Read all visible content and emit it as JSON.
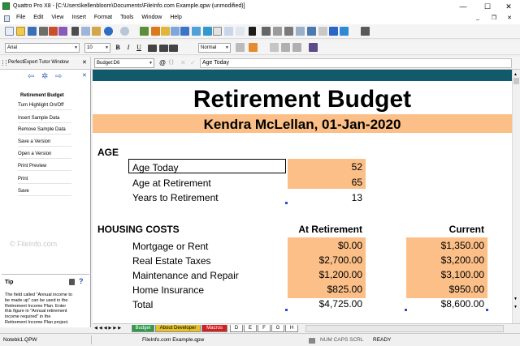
{
  "window": {
    "title": "Quattro Pro X8 - [C:\\Users\\kellenbloom\\Documents\\FileInfo.com Example.qpw (unmodified)]",
    "minimize": "—",
    "maximize": "☐",
    "close": "✕"
  },
  "menu": {
    "items": [
      "File",
      "Edit",
      "View",
      "Insert",
      "Format",
      "Tools",
      "Window",
      "Help"
    ],
    "mdi_minimize": "_",
    "mdi_restore": "❐",
    "mdi_close": "✕"
  },
  "format_toolbar": {
    "font": "Arial",
    "size": "10",
    "bold": "B",
    "italic": "I",
    "underline": "U",
    "style": "Normal"
  },
  "input_line": {
    "tutor_title": "PerfectExpert Tutor Window",
    "cell_address": "Budget:D6",
    "at_symbol": "@",
    "braces": "{ }",
    "cancel": "✕",
    "confirm": "✓",
    "content": "Age Today"
  },
  "tutor": {
    "nav_back": "⇦",
    "nav_home": "✲",
    "nav_forward": "⇨",
    "close": "✕",
    "heading": "Retirement Budget",
    "items": [
      "Turn Highlight On/Off",
      "Insert Sample Data",
      "Remove Sample Data",
      "Save a Version",
      "Open a Version",
      "Print Preview",
      "Print",
      "Save"
    ],
    "watermark": "© FileInfo.com",
    "tip_label": "Tip",
    "tip_help": "?",
    "tip_text": "The field called \"Annual income to be made up\" can be used in the Retirement Income Plan. Enter this figure in \"Annual retirement income required\" in the Retirement Income Plan project."
  },
  "sheet": {
    "title": "Retirement Budget",
    "subtitle": "Kendra McLellan, 01-Jan-2020",
    "age_header": "AGE",
    "age_rows": [
      {
        "label": "Age Today",
        "value": "52"
      },
      {
        "label": "Age at Retirement",
        "value": "65"
      },
      {
        "label": "Years to Retirement",
        "value": "13"
      }
    ],
    "housing_header": "HOUSING COSTS",
    "col_retirement": "At Retirement",
    "col_current": "Current",
    "housing_rows": [
      {
        "label": "Mortgage or Rent",
        "retirement": "$0.00",
        "current": "$1,350.00"
      },
      {
        "label": "Real Estate Taxes",
        "retirement": "$2,700.00",
        "current": "$3,200.00"
      },
      {
        "label": "Maintenance and Repair",
        "retirement": "$1,200.00",
        "current": "$3,100.00"
      },
      {
        "label": "Home Insurance",
        "retirement": "$825.00",
        "current": "$950.00"
      }
    ],
    "total_label": "Total",
    "total_retirement": "$4,725.00",
    "total_current": "$8,600.00"
  },
  "tabs": {
    "items": [
      {
        "label": "Budget",
        "color": "#2e9b4a",
        "text_color": "#ffffff"
      },
      {
        "label": "About Developer",
        "color": "#e6c229",
        "text_color": "#000000"
      },
      {
        "label": "Macros",
        "color": "#d21f1f",
        "text_color": "#ffffff"
      },
      {
        "label": "D",
        "color": "#ffffff",
        "text_color": "#000000"
      },
      {
        "label": "E",
        "color": "#ffffff",
        "text_color": "#000000"
      },
      {
        "label": "F",
        "color": "#ffffff",
        "text_color": "#000000"
      },
      {
        "label": "G",
        "color": "#ffffff",
        "text_color": "#000000"
      },
      {
        "label": "H",
        "color": "#ffffff",
        "text_color": "#000000"
      }
    ]
  },
  "status": {
    "notebook": "Notebk1.QPW",
    "file": "FileInfo.com Example.qpw",
    "indicators": "NUM  CAPS  SCRL",
    "mode": "READY"
  },
  "colors": {
    "accent_bar": "#12596b",
    "subtitle_band": "#fbbf87",
    "input_cell": "#fbbf87"
  }
}
